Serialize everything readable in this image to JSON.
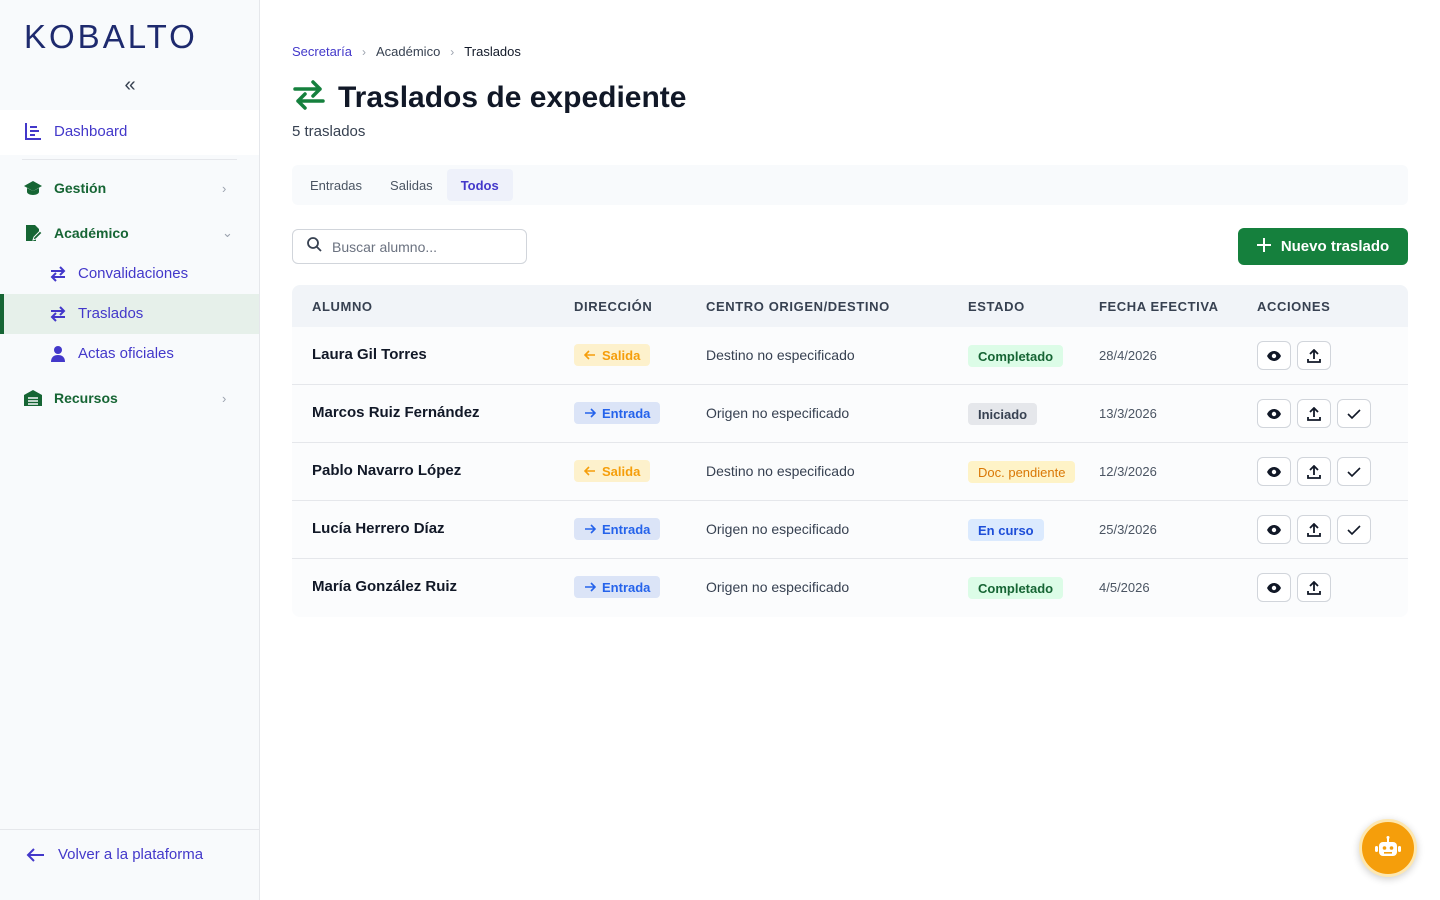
{
  "brand": {
    "logo": "KOBALTO"
  },
  "sidebar": {
    "collapse_label": "«",
    "dashboard": "Dashboard",
    "gestion": "Gestión",
    "academico": "Académico",
    "sub_items": [
      {
        "label": "Convalidaciones"
      },
      {
        "label": "Traslados"
      },
      {
        "label": "Actas oficiales"
      }
    ],
    "recursos": "Recursos",
    "footer": "Volver a la plataforma"
  },
  "breadcrumb": {
    "root": "Secretaría",
    "mid": "Académico",
    "current": "Traslados"
  },
  "page": {
    "title": "Traslados de expediente",
    "subtitle": "5 traslados"
  },
  "tabs": [
    "Entradas",
    "Salidas",
    "Todos"
  ],
  "search": {
    "placeholder": "Buscar alumno..."
  },
  "new_button": "Nuevo traslado",
  "table": {
    "headers": [
      "ALUMNO",
      "DIRECCIÓN",
      "CENTRO ORIGEN/DESTINO",
      "ESTADO",
      "FECHA EFECTIVA",
      "ACCIONES"
    ],
    "rows": [
      {
        "alumno": "Laura Gil Torres",
        "direccion": "Salida",
        "centro": "Destino no especificado",
        "estado": "Completado",
        "fecha": "28/4/2026"
      },
      {
        "alumno": "Marcos Ruiz Fernández",
        "direccion": "Entrada",
        "centro": "Origen no especificado",
        "estado": "Iniciado",
        "fecha": "13/3/2026"
      },
      {
        "alumno": "Pablo Navarro López",
        "direccion": "Salida",
        "centro": "Destino no especificado",
        "estado": "Doc. pendiente",
        "fecha": "12/3/2026"
      },
      {
        "alumno": "Lucía Herrero Díaz",
        "direccion": "Entrada",
        "centro": "Origen no especificado",
        "estado": "En curso",
        "fecha": "25/3/2026"
      },
      {
        "alumno": "María González Ruiz",
        "direccion": "Entrada",
        "centro": "Origen no especificado",
        "estado": "Completado",
        "fecha": "4/5/2026"
      }
    ]
  },
  "colors": {
    "primary_green": "#15803d",
    "accent_indigo": "#4338ca",
    "fab_orange": "#f59e0b"
  }
}
